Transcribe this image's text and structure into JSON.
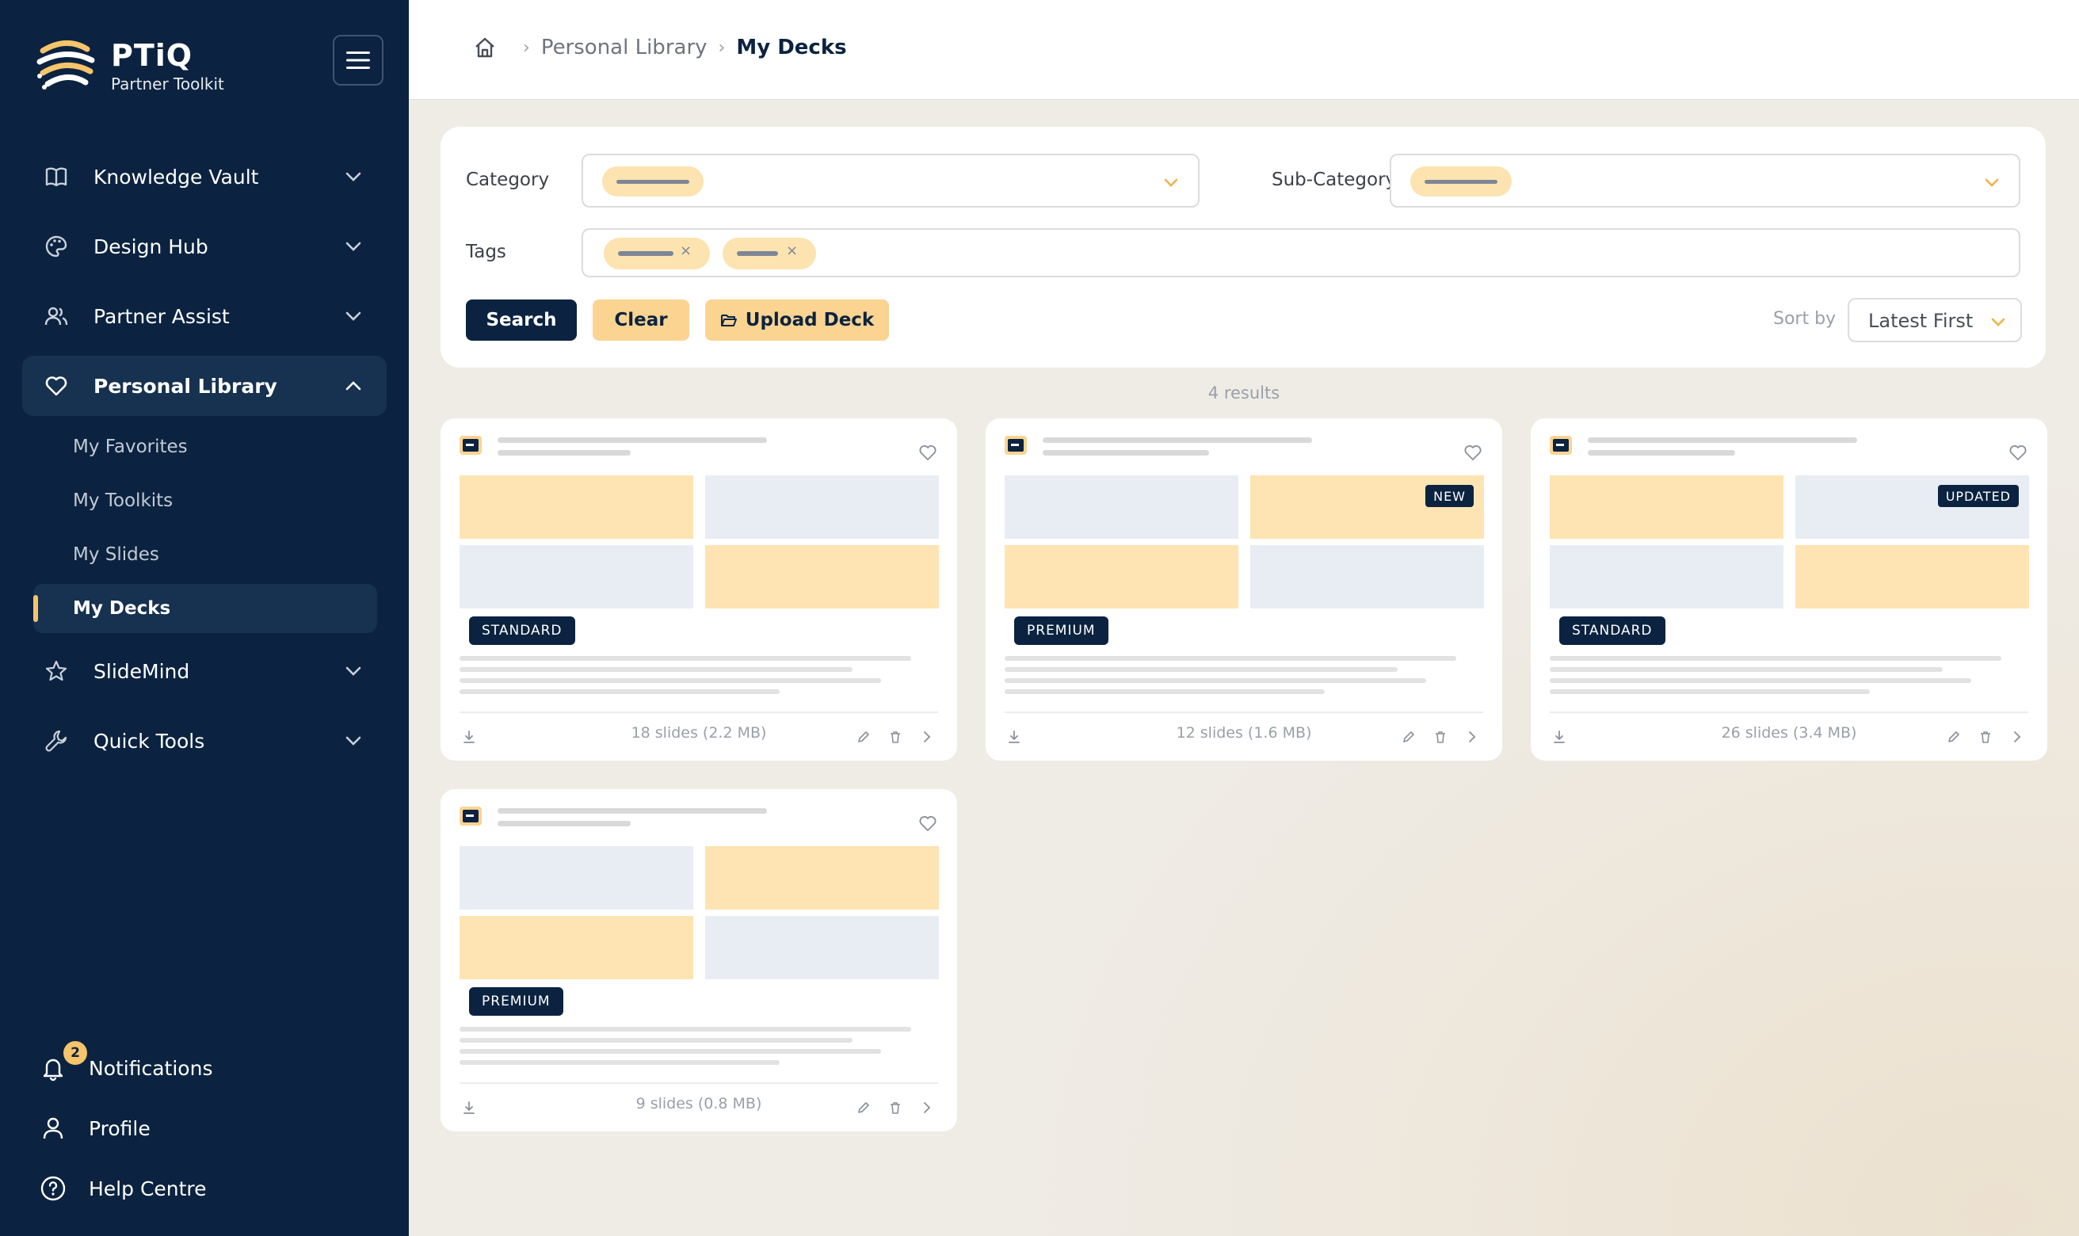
{
  "brand": {
    "name": "PTiQ",
    "subtitle": "Partner Toolkit"
  },
  "nav": {
    "items": [
      {
        "label": "Knowledge Vault",
        "icon": "book-icon",
        "expanded": false
      },
      {
        "label": "Design Hub",
        "icon": "palette-icon",
        "expanded": false
      },
      {
        "label": "Partner Assist",
        "icon": "users-icon",
        "expanded": false
      },
      {
        "label": "Personal Library",
        "icon": "heart-icon",
        "expanded": true
      },
      {
        "label": "SlideMind",
        "icon": "star-icon",
        "expanded": false
      },
      {
        "label": "Quick Tools",
        "icon": "wrench-icon",
        "expanded": false
      }
    ],
    "personal_library_children": [
      "My Favorites",
      "My Toolkits",
      "My Slides",
      "My Decks"
    ],
    "active_child": "My Decks"
  },
  "bottom_nav": {
    "notifications": {
      "label": "Notifications",
      "badge": "2"
    },
    "profile": {
      "label": "Profile"
    },
    "help": {
      "label": "Help Centre"
    }
  },
  "breadcrumb": {
    "parent": "Personal Library",
    "current": "My Decks"
  },
  "filters": {
    "category_label": "Category",
    "subcategory_label": "Sub-Category",
    "tags_label": "Tags",
    "search_label": "Search",
    "clear_label": "Clear",
    "upload_label": "Upload Deck",
    "sort_label": "Sort by",
    "sort_value": "Latest First"
  },
  "results": {
    "count_text": "4 results"
  },
  "cards": [
    {
      "tier": "STANDARD",
      "flag": "",
      "footer": "18 slides (2.2 MB)"
    },
    {
      "tier": "PREMIUM",
      "flag": "NEW",
      "footer": "12 slides (1.6 MB)"
    },
    {
      "tier": "STANDARD",
      "flag": "UPDATED",
      "footer": "26 slides (3.4 MB)"
    },
    {
      "tier": "PREMIUM",
      "flag": "",
      "footer": "9 slides (0.8 MB)"
    }
  ],
  "colors": {
    "sidebar": "#0b2340",
    "accent": "#f6c46a",
    "accent_light": "#fde3b0",
    "thumb_blue": "#e8edf4"
  }
}
